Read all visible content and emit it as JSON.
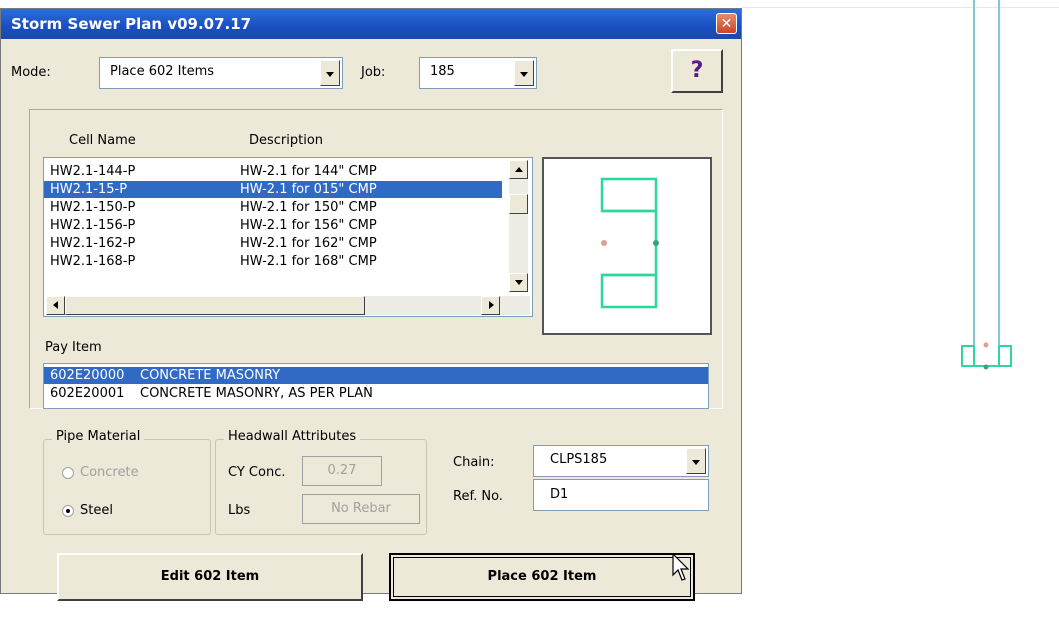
{
  "window": {
    "title": "Storm Sewer Plan v09.07.17",
    "close_glyph": "✕"
  },
  "toolbar": {
    "mode_label": "Mode:",
    "mode_value": "Place 602 Items",
    "job_label": "Job:",
    "job_value": "185",
    "help_glyph": "?"
  },
  "cells": {
    "col_name": "Cell Name",
    "col_description": "Description",
    "rows": [
      {
        "name": "HW2.1-144-P",
        "description": "HW-2.1 for 144\" CMP",
        "selected": false
      },
      {
        "name": "HW2.1-15-P",
        "description": "HW-2.1 for 015\" CMP",
        "selected": true
      },
      {
        "name": "HW2.1-150-P",
        "description": "HW-2.1 for 150\" CMP",
        "selected": false
      },
      {
        "name": "HW2.1-156-P",
        "description": "HW-2.1 for 156\" CMP",
        "selected": false
      },
      {
        "name": "HW2.1-162-P",
        "description": "HW-2.1 for 162\" CMP",
        "selected": false
      },
      {
        "name": "HW2.1-168-P",
        "description": "HW-2.1 for 168\" CMP",
        "selected": false
      }
    ]
  },
  "pay_item": {
    "label": "Pay Item",
    "rows": [
      {
        "code": "602E20000",
        "text": "CONCRETE MASONRY",
        "selected": true
      },
      {
        "code": "602E20001",
        "text": "CONCRETE MASONRY, AS PER PLAN",
        "selected": false
      }
    ]
  },
  "pipe_material": {
    "title": "Pipe Material",
    "options": [
      {
        "label": "Concrete",
        "selected": false,
        "enabled": false
      },
      {
        "label": "Steel",
        "selected": true,
        "enabled": true
      }
    ]
  },
  "headwall": {
    "title": "Headwall Attributes",
    "cy_label": "CY Conc.",
    "cy_value": "0.27",
    "lbs_label": "Lbs",
    "lbs_value": "No Rebar"
  },
  "chain": {
    "label": "Chain:",
    "value": "CLPS185"
  },
  "ref": {
    "label": "Ref. No.",
    "value": "D1"
  },
  "actions": {
    "edit_label": "Edit 602 Item",
    "place_label": "Place 602 Item"
  },
  "colors": {
    "title_bar": "#1a4fc0",
    "selection": "#316ac5",
    "cell_green": "#2ed6a0",
    "cad_blue": "#7ec8d8",
    "point_pink": "#e0a090"
  }
}
